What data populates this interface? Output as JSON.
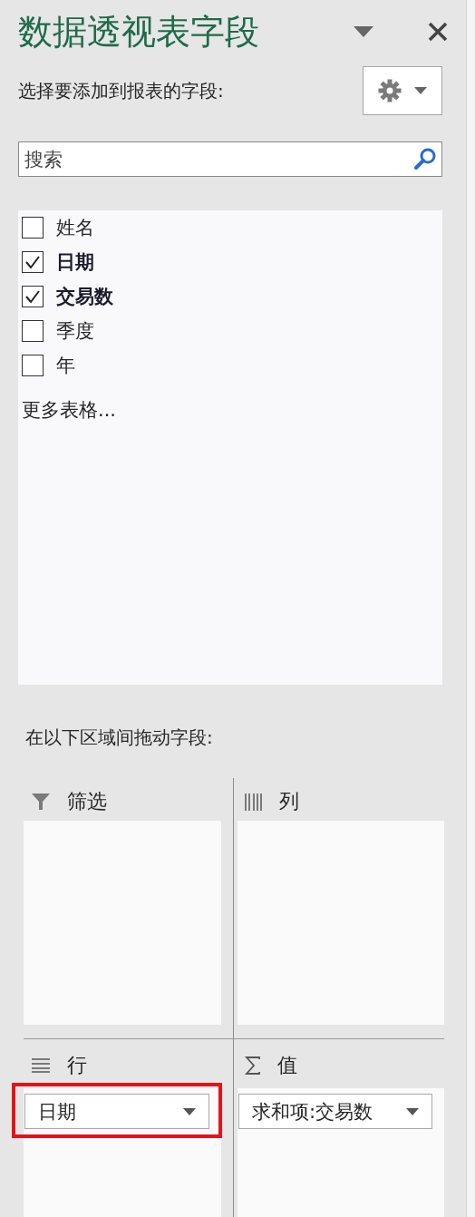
{
  "pane": {
    "title": "数据透视表字段",
    "choose_label": "选择要添加到报表的字段:",
    "search": {
      "placeholder": "搜索"
    }
  },
  "fields": [
    {
      "label": "姓名",
      "checked": false
    },
    {
      "label": "日期",
      "checked": true
    },
    {
      "label": "交易数",
      "checked": true
    },
    {
      "label": "季度",
      "checked": false
    },
    {
      "label": "年",
      "checked": false
    }
  ],
  "more_tables": "更多表格...",
  "drag_label": "在以下区域间拖动字段:",
  "areas": [
    {
      "kind": "filter",
      "label": "筛选"
    },
    {
      "kind": "columns",
      "label": "列"
    },
    {
      "kind": "rows",
      "label": "行",
      "items": [
        {
          "label": "日期",
          "highlighted": true
        }
      ]
    },
    {
      "kind": "values",
      "label": "值",
      "items": [
        {
          "label": "求和项:交易数",
          "highlighted": false
        }
      ]
    }
  ]
}
